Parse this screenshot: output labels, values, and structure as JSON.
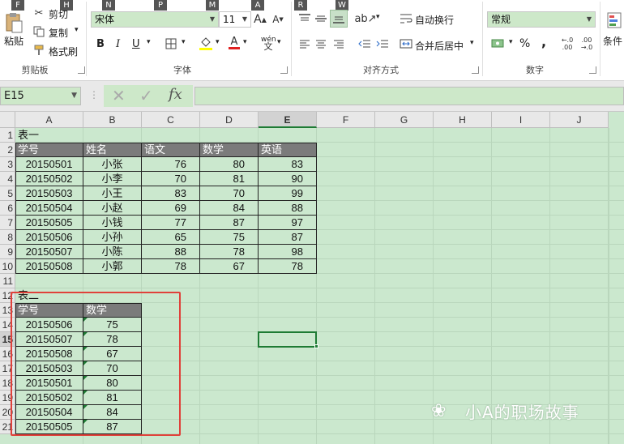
{
  "keytips": {
    "cut": "F",
    "paste_h": "H",
    "font_n": "N",
    "font_p": "P",
    "font_m": "M",
    "font_a": "A",
    "align_r": "R",
    "align_w": "W"
  },
  "clipboard": {
    "paste": "粘贴",
    "cut": "剪切",
    "copy": "复制",
    "format_painter": "格式刷",
    "label": "剪贴板"
  },
  "font": {
    "name": "宋体",
    "size": "11",
    "label": "字体",
    "bold": "B",
    "italic": "I",
    "underline": "U",
    "phonetic": "wén"
  },
  "alignment": {
    "wrap": "自动换行",
    "merge": "合并后居中",
    "label": "对齐方式"
  },
  "number": {
    "format": "常规",
    "percent": "%",
    "comma": ",",
    "label": "数字",
    "inc_dec": ".0\n.00",
    "dec_dec": ".00\n.0"
  },
  "styles": {
    "conditional": "条件"
  },
  "namebox": {
    "value": "E15"
  },
  "formula": {
    "fx": "fx",
    "value": ""
  },
  "columns": [
    "A",
    "B",
    "C",
    "D",
    "E",
    "F",
    "G",
    "H",
    "I",
    "J"
  ],
  "rows": [
    "1",
    "2",
    "3",
    "4",
    "5",
    "6",
    "7",
    "8",
    "9",
    "10",
    "11",
    "12",
    "13",
    "14",
    "15",
    "16",
    "17",
    "18",
    "19",
    "20",
    "21"
  ],
  "table1": {
    "title": "表一",
    "headers": [
      "学号",
      "姓名",
      "语文",
      "数学",
      "英语"
    ],
    "rows": [
      [
        "20150501",
        "小张",
        "76",
        "80",
        "83"
      ],
      [
        "20150502",
        "小李",
        "70",
        "81",
        "90"
      ],
      [
        "20150503",
        "小王",
        "83",
        "70",
        "99"
      ],
      [
        "20150504",
        "小赵",
        "69",
        "84",
        "88"
      ],
      [
        "20150505",
        "小钱",
        "77",
        "87",
        "97"
      ],
      [
        "20150506",
        "小孙",
        "65",
        "75",
        "87"
      ],
      [
        "20150507",
        "小陈",
        "88",
        "78",
        "98"
      ],
      [
        "20150508",
        "小郭",
        "78",
        "67",
        "78"
      ]
    ]
  },
  "table2": {
    "title": "表二",
    "headers": [
      "学号",
      "数学"
    ],
    "rows": [
      [
        "20150506",
        "75"
      ],
      [
        "20150507",
        "78"
      ],
      [
        "20150508",
        "67"
      ],
      [
        "20150503",
        "70"
      ],
      [
        "20150501",
        "80"
      ],
      [
        "20150502",
        "81"
      ],
      [
        "20150504",
        "84"
      ],
      [
        "20150505",
        "87"
      ]
    ]
  },
  "watermark": {
    "text": "小A的职场故事"
  },
  "colors": {
    "highlight_box": "#e0413a",
    "grid_bg": "#cbe8ce",
    "header_fill": "#7b7b7b",
    "selection": "#1e7b34"
  }
}
